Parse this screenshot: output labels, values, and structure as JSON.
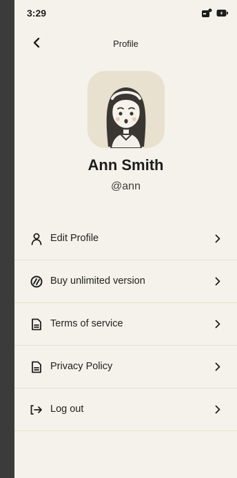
{
  "status": {
    "time": "3:29"
  },
  "nav": {
    "title": "Profile"
  },
  "profile": {
    "name": "Ann Smith",
    "handle": "@ann"
  },
  "menu": [
    {
      "label": "Edit Profile",
      "icon": "user-icon"
    },
    {
      "label": "Buy unlimited version",
      "icon": "badge-icon"
    },
    {
      "label": "Terms of service",
      "icon": "document-icon"
    },
    {
      "label": "Privacy Policy",
      "icon": "document-icon"
    },
    {
      "label": "Log out",
      "icon": "logout-icon"
    }
  ],
  "colors": {
    "background": "#f4f2ea",
    "avatar_bg": "#e8e1d0",
    "divider": "#e4e0d4"
  }
}
